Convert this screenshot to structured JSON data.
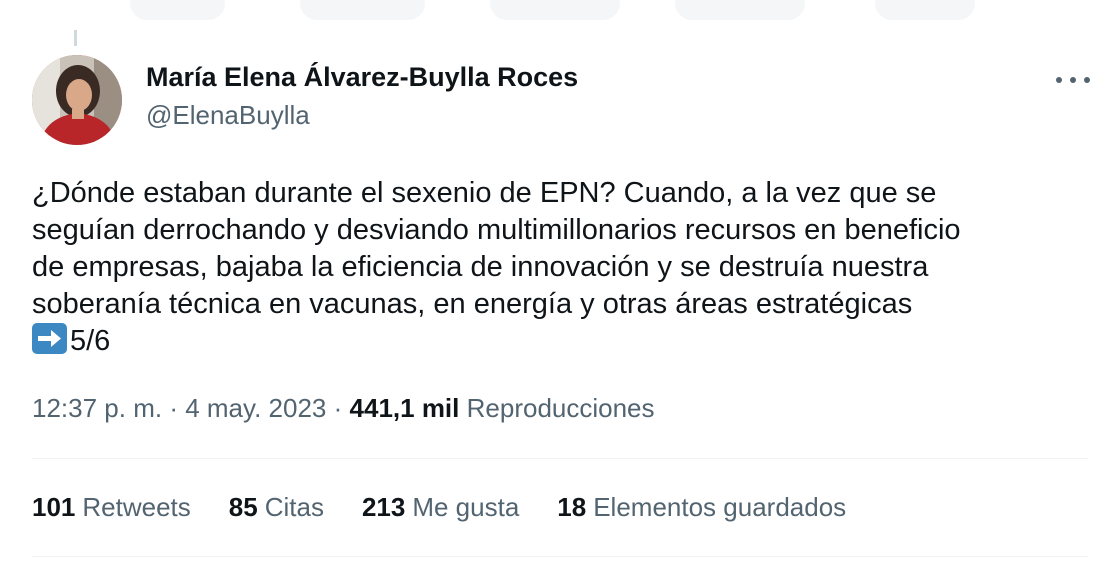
{
  "author": {
    "name": "María Elena Álvarez-Buylla Roces",
    "handle": "@ElenaBuylla"
  },
  "tweet": {
    "lines": [
      "¿Dónde estaban durante el sexenio de EPN? Cuando, a la vez que se",
      "seguían derrochando y desviando multimillonarios recursos en beneficio",
      "de empresas, bajaba la eficiencia de innovación y se destruía nuestra",
      "soberanía técnica en vacunas, en energía y otras áreas estratégicas"
    ],
    "emoji": "arrow-right-emoji",
    "thread_counter": "5/6"
  },
  "meta": {
    "time": "12:37 p. m.",
    "separator": "·",
    "date": "4 may. 2023",
    "views_count": "441,1 mil",
    "views_label": "Reproducciones"
  },
  "stats": {
    "retweets": {
      "count": "101",
      "label": "Retweets"
    },
    "quotes": {
      "count": "85",
      "label": "Citas"
    },
    "likes": {
      "count": "213",
      "label": "Me gusta"
    },
    "bookmarks": {
      "count": "18",
      "label": "Elementos guardados"
    }
  },
  "colors": {
    "text": "#0f1419",
    "secondary": "#536471",
    "divider": "#eff3f4",
    "emoji_blue": "#3b88c3"
  }
}
